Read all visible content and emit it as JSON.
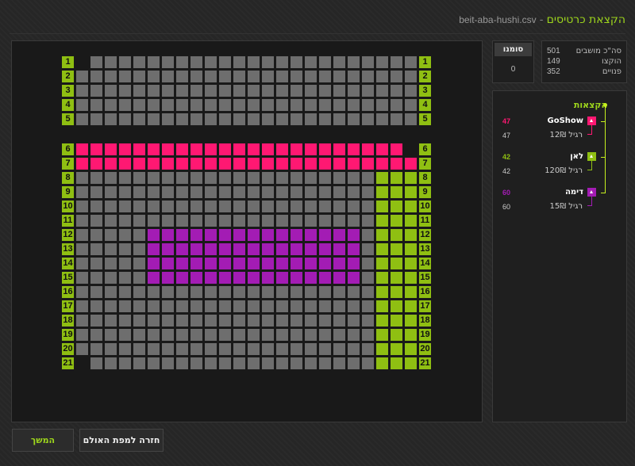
{
  "header": {
    "title": "הקצאת כרטיסים",
    "separator": "-",
    "file": "beit-aba-hushi.csv"
  },
  "stats": [
    {
      "label": "סה\"כ מושבים",
      "value": "501"
    },
    {
      "label": "הוקצו",
      "value": "149"
    },
    {
      "label": "פנויים",
      "value": "352"
    }
  ],
  "marked": {
    "label": "סומנו",
    "value": "0"
  },
  "allocations": {
    "title": "הקצאות",
    "groups": [
      {
        "name": "GoShow",
        "count": "47",
        "color": "#ff1872",
        "sub_label": "רגיל 12₪",
        "sub_count": "47"
      },
      {
        "name": "לאן",
        "count": "42",
        "color": "#8fbf12",
        "sub_label": "רגיל 120₪",
        "sub_count": "42"
      },
      {
        "name": "דימה",
        "count": "60",
        "color": "#a31cb4",
        "sub_label": "רגיל 15₪",
        "sub_count": "60"
      }
    ]
  },
  "buttons": {
    "next": "המשך",
    "back": "חזרה למפת האולם"
  },
  "seatmap": {
    "columns": 24,
    "colors": {
      "empty": "#6e6e6e",
      "GoShow": "#ff1872",
      "לאן": "#8fbf12",
      "דימה": "#a31cb4",
      "label": "#8fbf12"
    },
    "rows": [
      {
        "label": "1",
        "missing": [
          0
        ]
      },
      {
        "label": "2",
        "missing": []
      },
      {
        "label": "3",
        "missing": []
      },
      {
        "label": "4",
        "missing": []
      },
      {
        "label": "5",
        "missing": []
      },
      {
        "label": "6",
        "missing": [
          23
        ],
        "blocks": [
          {
            "from": 0,
            "to": 22,
            "group": "GoShow"
          }
        ]
      },
      {
        "label": "7",
        "missing": [],
        "blocks": [
          {
            "from": 0,
            "to": 23,
            "group": "GoShow"
          }
        ]
      },
      {
        "label": "8",
        "missing": [],
        "blocks": [
          {
            "from": 21,
            "to": 23,
            "group": "לאן"
          }
        ]
      },
      {
        "label": "9",
        "missing": [],
        "blocks": [
          {
            "from": 21,
            "to": 23,
            "group": "לאן"
          }
        ]
      },
      {
        "label": "10",
        "missing": [],
        "blocks": [
          {
            "from": 21,
            "to": 23,
            "group": "לאן"
          }
        ]
      },
      {
        "label": "11",
        "missing": [],
        "blocks": [
          {
            "from": 21,
            "to": 23,
            "group": "לאן"
          }
        ]
      },
      {
        "label": "12",
        "missing": [],
        "blocks": [
          {
            "from": 5,
            "to": 19,
            "group": "דימה"
          },
          {
            "from": 21,
            "to": 23,
            "group": "לאן"
          }
        ]
      },
      {
        "label": "13",
        "missing": [],
        "blocks": [
          {
            "from": 5,
            "to": 19,
            "group": "דימה"
          },
          {
            "from": 21,
            "to": 23,
            "group": "לאן"
          }
        ]
      },
      {
        "label": "14",
        "missing": [],
        "blocks": [
          {
            "from": 5,
            "to": 19,
            "group": "דימה"
          },
          {
            "from": 21,
            "to": 23,
            "group": "לאן"
          }
        ]
      },
      {
        "label": "15",
        "missing": [],
        "blocks": [
          {
            "from": 5,
            "to": 19,
            "group": "דימה"
          },
          {
            "from": 21,
            "to": 23,
            "group": "לאן"
          }
        ]
      },
      {
        "label": "16",
        "missing": [],
        "blocks": [
          {
            "from": 21,
            "to": 23,
            "group": "לאן"
          }
        ]
      },
      {
        "label": "17",
        "missing": [],
        "blocks": [
          {
            "from": 21,
            "to": 23,
            "group": "לאן"
          }
        ]
      },
      {
        "label": "18",
        "missing": [],
        "blocks": [
          {
            "from": 21,
            "to": 23,
            "group": "לאן"
          }
        ]
      },
      {
        "label": "19",
        "missing": [],
        "blocks": [
          {
            "from": 21,
            "to": 23,
            "group": "לאן"
          }
        ]
      },
      {
        "label": "20",
        "missing": [],
        "blocks": [
          {
            "from": 21,
            "to": 23,
            "group": "לאן"
          }
        ]
      },
      {
        "label": "21",
        "missing": [
          0
        ],
        "blocks": [
          {
            "from": 21,
            "to": 23,
            "group": "לאן"
          }
        ]
      }
    ]
  }
}
